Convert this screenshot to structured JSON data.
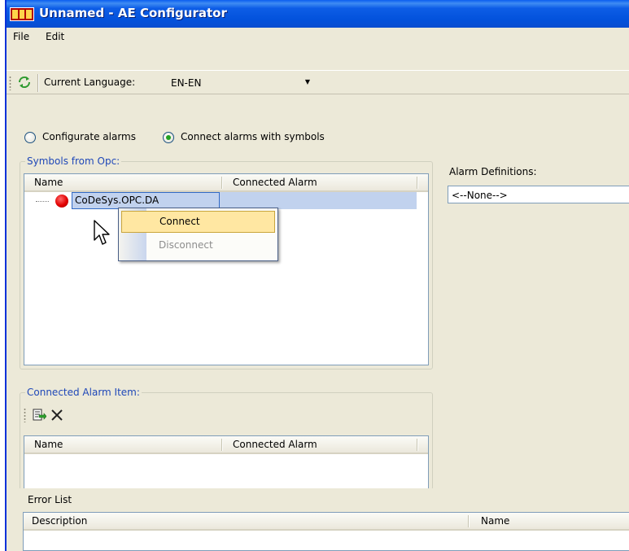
{
  "window": {
    "title": "Unnamed - AE Configurator"
  },
  "menu": {
    "items": [
      "File",
      "Edit"
    ]
  },
  "toolbar": {
    "refresh_icon": "refresh-icon",
    "language_label": "Current Language:",
    "language_value": "EN-EN"
  },
  "mode": {
    "options": [
      {
        "label": "Configurate alarms",
        "checked": false
      },
      {
        "label": "Connect alarms with symbols",
        "checked": true
      }
    ]
  },
  "symbols": {
    "group_title": "Symbols from Opc:",
    "columns": [
      "Name",
      "Connected Alarm"
    ],
    "rows": [
      {
        "name": "CoDeSys.OPC.DA",
        "connected_alarm": ""
      }
    ]
  },
  "context_menu": {
    "items": [
      {
        "label": "Connect",
        "enabled": true,
        "highlighted": true
      },
      {
        "label": "Disconnect",
        "enabled": false,
        "highlighted": false
      }
    ]
  },
  "alarm_definitions": {
    "label": "Alarm Definitions:",
    "value": "<--None-->"
  },
  "connected_alarm_item": {
    "group_title": "Connected Alarm Item:",
    "toolbar_icons": [
      "edit-icon",
      "delete-icon"
    ],
    "columns": [
      "Name",
      "Connected Alarm"
    ]
  },
  "error_list": {
    "title": "Error List",
    "columns": [
      "Description",
      "Name"
    ]
  },
  "colors": {
    "titlebar": "#0352dc",
    "selection": "#c1d2ee",
    "menu_hover": "#ffe7a2",
    "group_title": "#1f48b8"
  }
}
